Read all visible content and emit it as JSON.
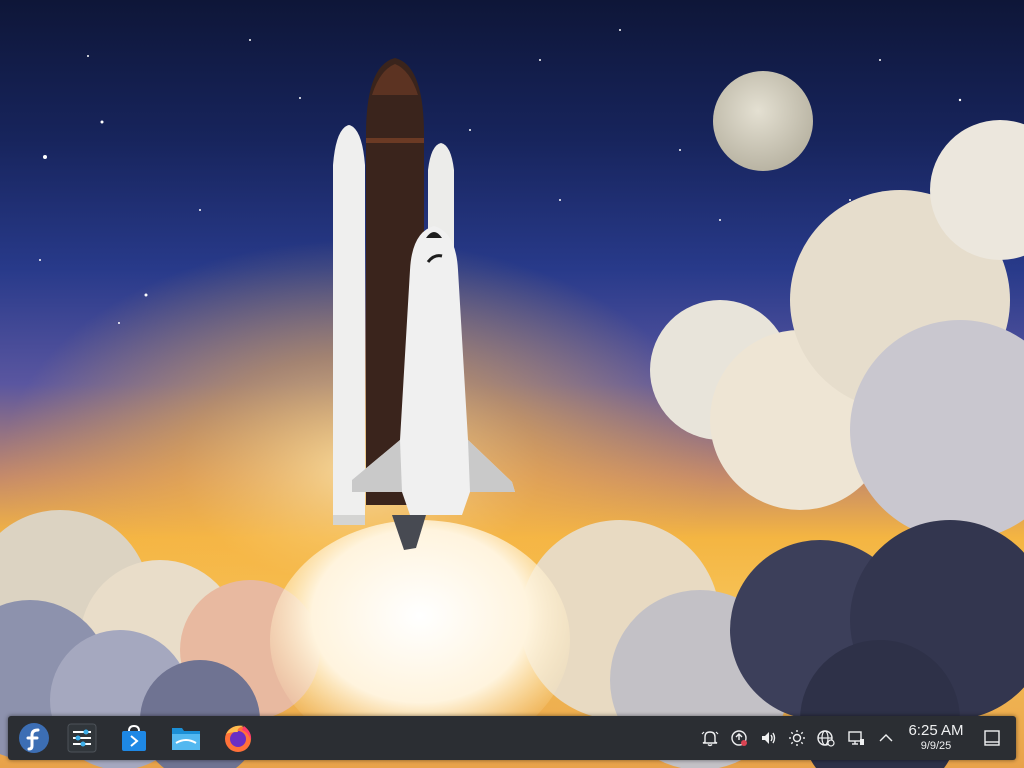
{
  "wallpaper": {
    "name": "space-shuttle-launch"
  },
  "panel": {
    "launchers": [
      {
        "name": "fedora-launcher",
        "icon": "fedora-logo-icon"
      },
      {
        "name": "system-settings",
        "icon": "settings-sliders-icon"
      },
      {
        "name": "discover",
        "icon": "shopping-bag-icon"
      },
      {
        "name": "dolphin-file-manager",
        "icon": "folder-icon"
      },
      {
        "name": "firefox",
        "icon": "firefox-icon"
      }
    ],
    "tray": [
      {
        "name": "notifications",
        "icon": "bell-icon"
      },
      {
        "name": "updates",
        "icon": "update-alert-icon"
      },
      {
        "name": "volume",
        "icon": "speaker-icon"
      },
      {
        "name": "brightness",
        "icon": "sun-icon"
      },
      {
        "name": "network",
        "icon": "globe-icon"
      },
      {
        "name": "display",
        "icon": "monitor-icon"
      },
      {
        "name": "show-hidden-icons",
        "icon": "chevron-up-icon"
      }
    ],
    "clock": {
      "time": "6:25 AM",
      "date": "9/9/25"
    },
    "show_desktop": {
      "icon": "show-desktop-icon"
    }
  },
  "colors": {
    "panel": "#2b2e33",
    "accent": "#3d8fd6",
    "fedora_blue": "#3c6eb4",
    "text": "#eff0f1"
  }
}
